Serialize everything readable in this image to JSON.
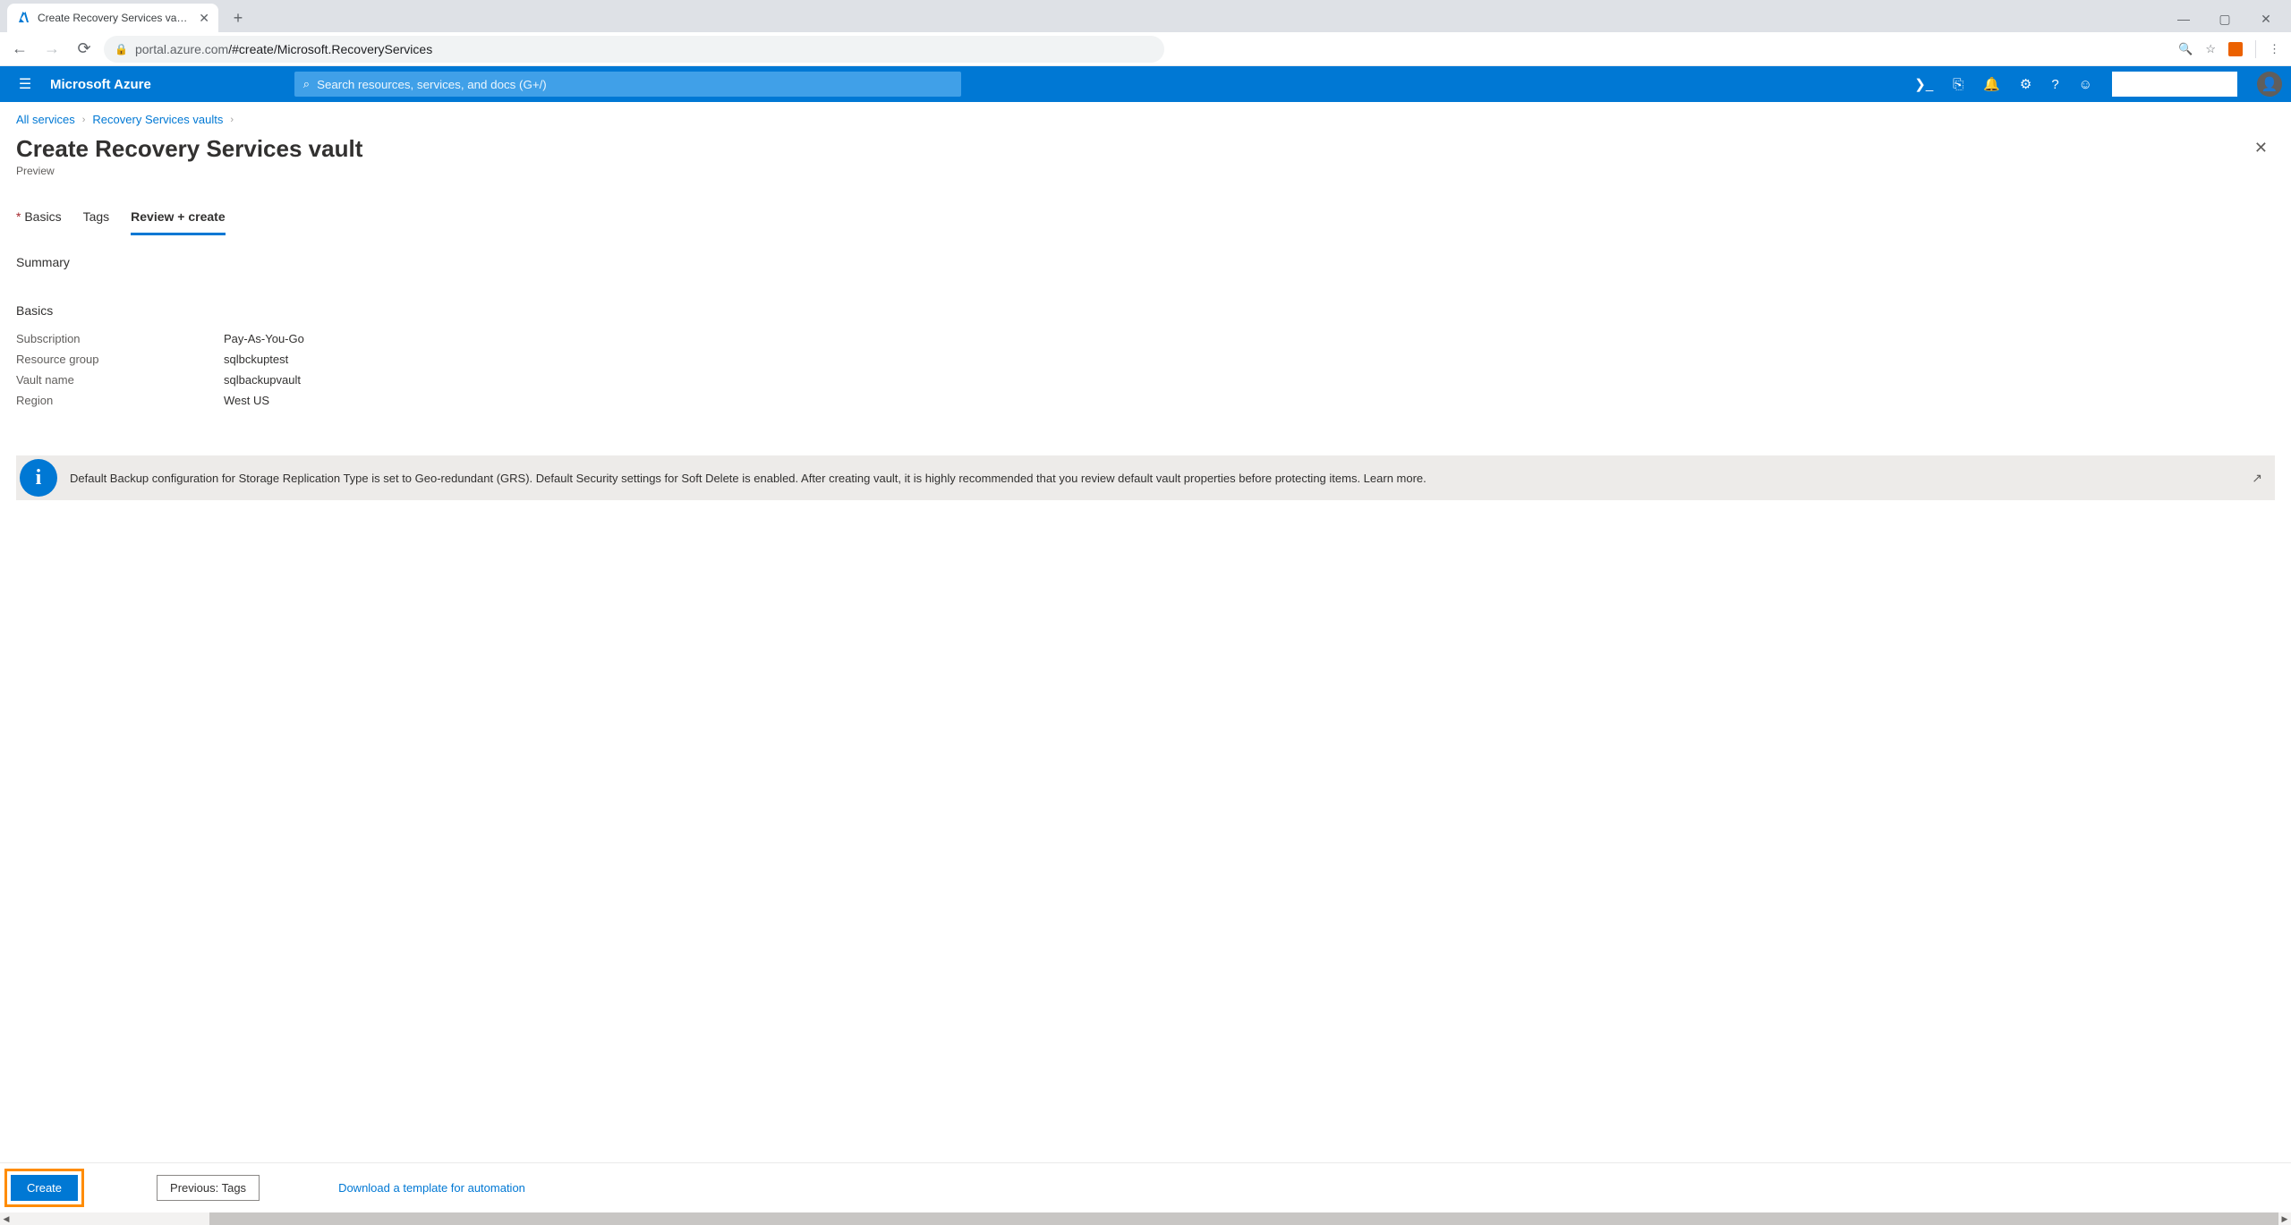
{
  "browser": {
    "tab_title": "Create Recovery Services vault - ",
    "address_host": "portal.azure.com",
    "address_path": "/#create/Microsoft.RecoveryServices"
  },
  "azure_header": {
    "brand": "Microsoft Azure",
    "search_placeholder": "Search resources, services, and docs (G+/)"
  },
  "breadcrumb": {
    "level1": "All services",
    "level2": "Recovery Services vaults"
  },
  "page_title": "Create Recovery Services vault",
  "page_subtitle": "Preview",
  "tabs": {
    "basics": "Basics",
    "tags": "Tags",
    "review": "Review + create"
  },
  "summary_label": "Summary",
  "basics_section_label": "Basics",
  "basics": {
    "subscription_label": "Subscription",
    "subscription_value": "Pay-As-You-Go",
    "resource_group_label": "Resource group",
    "resource_group_value": "sqlbckuptest",
    "vault_name_label": "Vault name",
    "vault_name_value": "sqlbackupvault",
    "region_label": "Region",
    "region_value": "West US"
  },
  "info_banner": "Default Backup configuration for Storage Replication Type is set to Geo-redundant (GRS). Default Security settings for Soft Delete is enabled. After creating vault, it is highly recommended that you review default vault properties before protecting items. Learn more.",
  "footer": {
    "create": "Create",
    "previous": "Previous: Tags",
    "download_template": "Download a template for automation"
  }
}
